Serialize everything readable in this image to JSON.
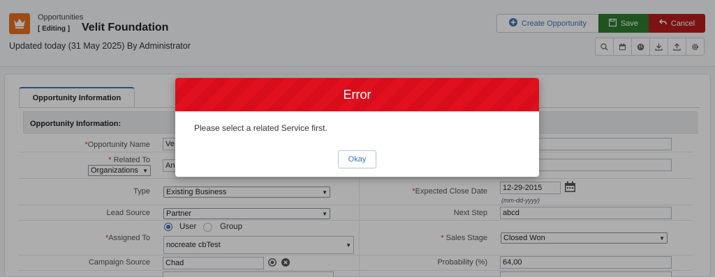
{
  "header": {
    "breadcrumb": "Opportunities",
    "editing_tag": "[ Editing ]",
    "title": "Velit Foundation",
    "updated": "Updated today (31 May 2025) By Administrator",
    "logo_icon": "crown-icon",
    "create_label": "Create Opportunity",
    "save_label": "Save",
    "cancel_label": "Cancel",
    "toolbar_icons": [
      "search-icon",
      "calendar-icon",
      "globe-icon",
      "download-icon",
      "upload-icon",
      "gear-icon"
    ]
  },
  "tabs": {
    "active": "Opportunity Information"
  },
  "section": {
    "title": "Opportunity Information:"
  },
  "form": {
    "opportunity_name": {
      "label": "Opportunity Name",
      "value": "Ve"
    },
    "related_to": {
      "label": "Related To",
      "select": "Organizations",
      "value": "An"
    },
    "type": {
      "label": "Type",
      "value": "Existing Business"
    },
    "lead_source": {
      "label": "Lead Source",
      "value": "Partner"
    },
    "assigned_to": {
      "label": "Assigned To",
      "option_user": "User",
      "option_group": "Group",
      "value": "nocreate cbTest"
    },
    "campaign_source": {
      "label": "Campaign Source",
      "value": "Chad"
    },
    "expected_close_date": {
      "label": "Expected Close Date",
      "value": "12-29-2015",
      "format": "(mm-dd-yyyy)"
    },
    "next_step": {
      "label": "Next Step",
      "value": "abcd"
    },
    "sales_stage": {
      "label": "Sales Stage",
      "value": "Closed Won"
    },
    "probability": {
      "label": "Probability (%)",
      "value": "64,00"
    }
  },
  "modal": {
    "title": "Error",
    "message": "Please select a related Service first.",
    "ok_label": "Okay"
  },
  "colors": {
    "accent": "#3b73b9",
    "save": "#2e7d32",
    "cancel": "#b71c1c",
    "error_header": "#e0101f",
    "logo": "#e8711f"
  }
}
